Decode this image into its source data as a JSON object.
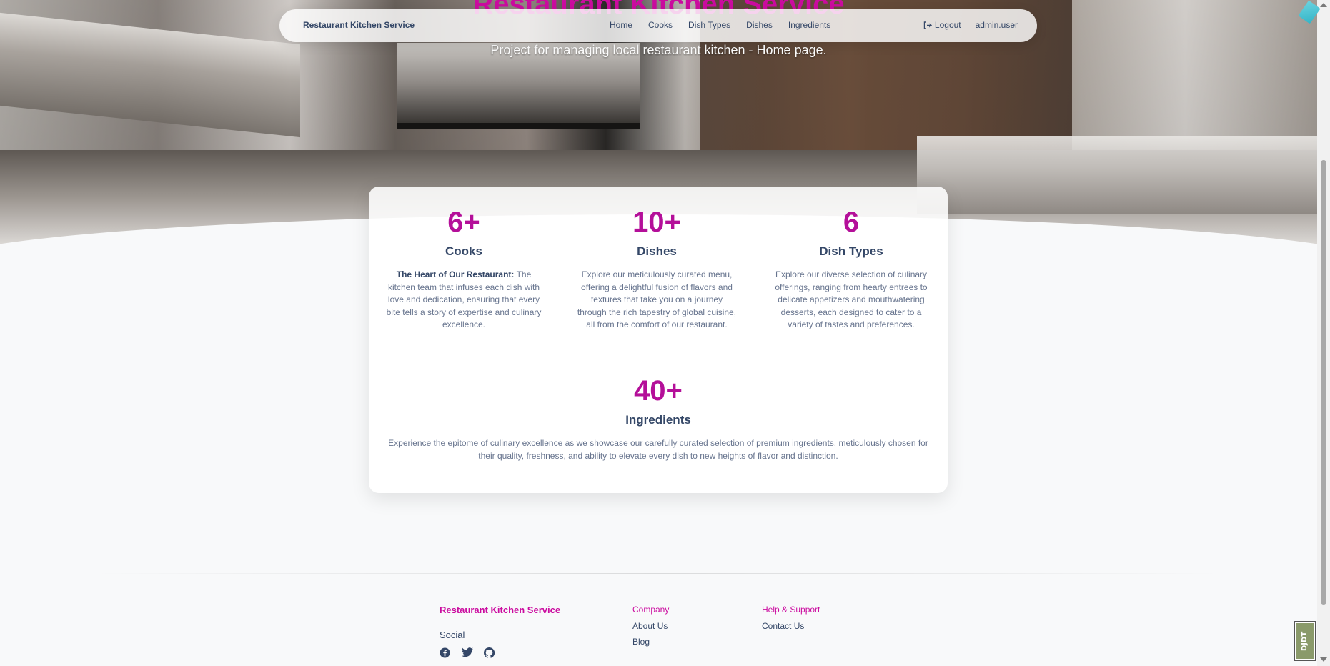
{
  "hero": {
    "title": "Restaurant Kitchen Service",
    "subtitle": "Project for managing local restaurant kitchen - Home page."
  },
  "navbar": {
    "brand": "Restaurant Kitchen Service",
    "links": [
      "Home",
      "Cooks",
      "Dish Types",
      "Dishes",
      "Ingredients"
    ],
    "logout_label": "Logout",
    "user": "admin.user"
  },
  "stats": [
    {
      "number": "6+",
      "title": "Cooks",
      "desc_bold": "The Heart of Our Restaurant:",
      "desc": "The kitchen team that infuses each dish with love and dedication, ensuring that every bite tells a story of expertise and culinary excellence."
    },
    {
      "number": "10+",
      "title": "Dishes",
      "desc": "Explore our meticulously curated menu, offering a delightful fusion of flavors and textures that take you on a journey through the rich tapestry of global cuisine, all from the comfort of our restaurant."
    },
    {
      "number": "6",
      "title": "Dish Types",
      "desc": "Explore our diverse selection of culinary offerings, ranging from hearty entrees to delicate appetizers and mouthwatering desserts, each designed to cater to a variety of tastes and preferences."
    },
    {
      "number": "40+",
      "title": "Ingredients",
      "desc": "Experience the epitome of culinary excellence as we showcase our carefully curated selection of premium ingredients, meticulously chosen for their quality, freshness, and ability to elevate every dish to new heights of flavor and distinction."
    }
  ],
  "footer": {
    "brand": "Restaurant Kitchen Service",
    "social_title": "Social",
    "social_icons": [
      "facebook-icon",
      "twitter-icon",
      "github-icon"
    ],
    "company_title": "Company",
    "company_links": [
      "About Us",
      "Blog"
    ],
    "help_title": "Help & Support",
    "help_links": [
      "Contact Us"
    ]
  },
  "debug_toolbar": {
    "label": "DJDT"
  },
  "colors": {
    "accent": "#cb0c9f",
    "number": "#b40f99",
    "text": "#344767",
    "muted": "#67748e"
  }
}
